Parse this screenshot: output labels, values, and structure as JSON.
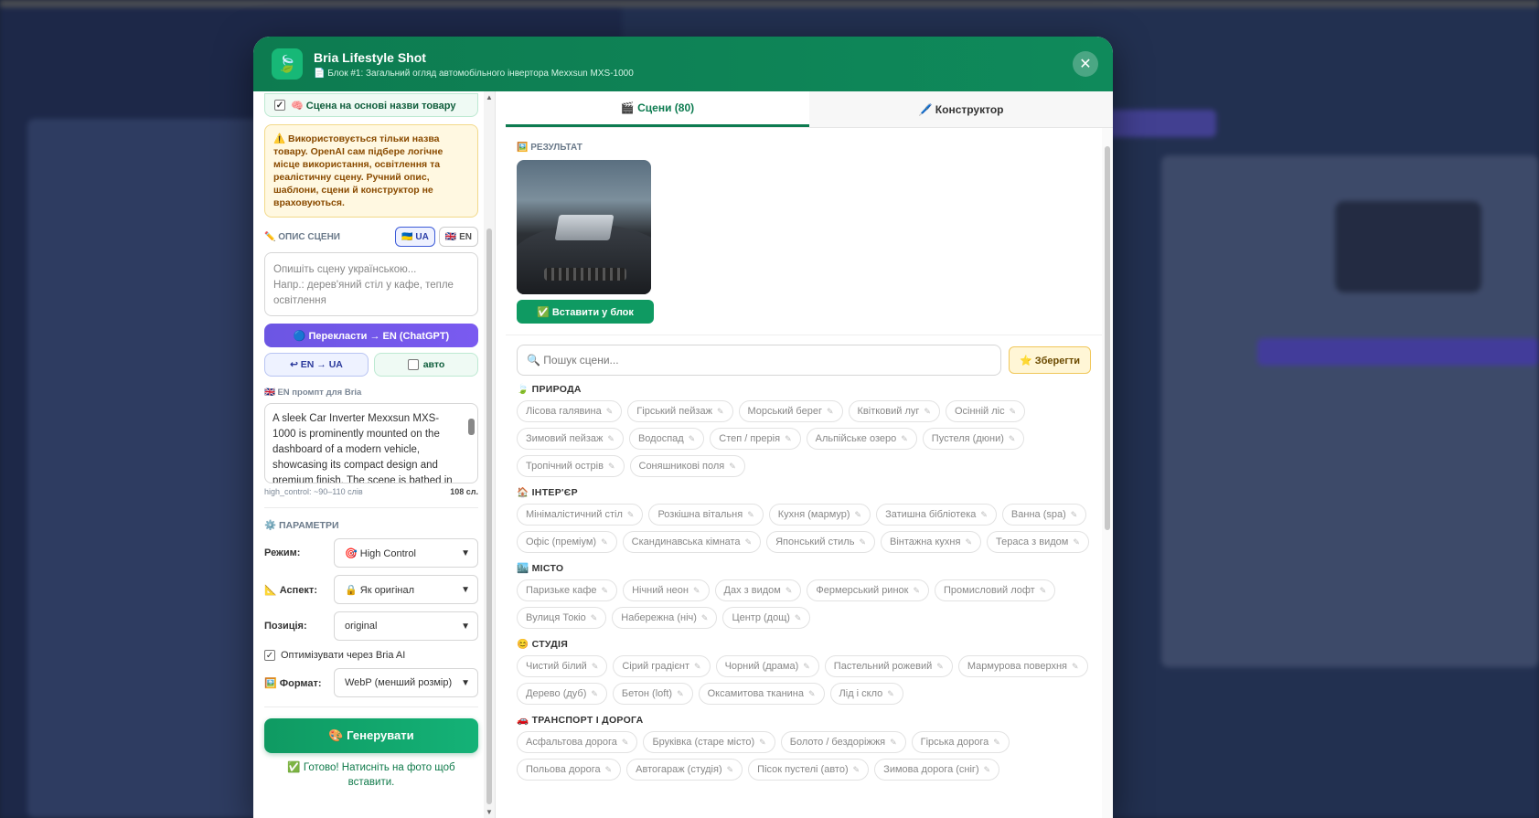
{
  "modal": {
    "title": "Bria Lifestyle Shot",
    "subtitle": "📄 Блок #1: Загальний огляд автомобільного інвертора Mexxsun MXS-1000",
    "close": "✕"
  },
  "left": {
    "scene_from_name": "🧠 Сцена на основі назви товару",
    "warning": "⚠️ Використовується тільки назва товару. OpenAI сам підбере логічне місце використання, освітлення та реалістичну сцену. Ручний опис, шаблони, сцени й конструктор не враховуються.",
    "scene_desc_label": "✏️ ОПИС СЦЕНИ",
    "lang_ua": "🇺🇦 UA",
    "lang_en": "🇬🇧 EN",
    "scene_placeholder": "Опишіть сцену українською...\nНапр.: дерев'яний стіл у кафе, тепле освітлення",
    "translate_btn": "🔵 Перекласти → EN (ChatGPT)",
    "en_ua_btn": "↩ EN → UA",
    "auto_label": "авто",
    "en_prompt_label": "🇬🇧 EN промпт для Bria",
    "en_prompt": "A sleek Car Inverter Mexxsun MXS-1000 is prominently mounted on the dashboard of a modern vehicle, showcasing its compact design and premium finish. The scene is bathed in",
    "meta_left": "high_control: ~90–110 слів",
    "meta_right": "108 сл.",
    "params_label": "⚙️ ПАРАМЕТРИ",
    "params": [
      {
        "label": "Режим:",
        "value": "🎯 High Control"
      },
      {
        "label": "📐 Аспект:",
        "value": "🔒 Як оригінал"
      },
      {
        "label": "Позиція:",
        "value": "original"
      }
    ],
    "optimize_label": "Оптимізувати через Bria AI",
    "format_label": "🖼️ Формат:",
    "format_value": "WebP (менший розмір)",
    "generate_btn": "🎨 Генерувати",
    "ready_text": "✅ Готово! Натисніть на фото щоб вставити."
  },
  "tabs": [
    {
      "label": "🎬 Сцени (80)"
    },
    {
      "label": "🖊️ Конструктор"
    }
  ],
  "result": {
    "label": "🖼️ РЕЗУЛЬТАТ",
    "insert_btn": "✅ Вставити у блок"
  },
  "search": {
    "placeholder": "🔍 Пошук сцени...",
    "save_btn": "⭐ Зберегти"
  },
  "categories": [
    {
      "title": "🍃 ПРИРОДА",
      "items": [
        "Лісова галявина",
        "Гірський пейзаж",
        "Морський берег",
        "Квітковий луг",
        "Осінній ліс",
        "Зимовий пейзаж",
        "Водоспад",
        "Степ / прерія",
        "Альпійське озеро",
        "Пустеля (дюни)",
        "Тропічний острів",
        "Соняшникові поля"
      ]
    },
    {
      "title": "🏠 ІНТЕР'ЄР",
      "items": [
        "Мінімалістичний стіл",
        "Розкішна вітальня",
        "Кухня (мармур)",
        "Затишна бібліотека",
        "Ванна (spa)",
        "Офіс (преміум)",
        "Скандинавська кімната",
        "Японський стиль",
        "Вінтажна кухня",
        "Тераса з видом"
      ]
    },
    {
      "title": "🏙️ МІСТО",
      "items": [
        "Паризьке кафе",
        "Нічний неон",
        "Дах з видом",
        "Фермерський ринок",
        "Промисловий лофт",
        "Вулиця Токіо",
        "Набережна (ніч)",
        "Центр (дощ)"
      ]
    },
    {
      "title": "😊 СТУДІЯ",
      "items": [
        "Чистий білий",
        "Сірий градієнт",
        "Чорний (драма)",
        "Пастельний рожевий",
        "Мармурова поверхня",
        "Дерево (дуб)",
        "Бетон (loft)",
        "Оксамитова тканина",
        "Лід і скло"
      ]
    },
    {
      "title": "🚗 ТРАНСПОРТ І ДОРОГА",
      "items": [
        "Асфальтова дорога",
        "Бруківка (старе місто)",
        "Болото / бездоріжжя",
        "Гірська дорога",
        "Польова дорога",
        "Автогараж (студія)",
        "Пісок пустелі (авто)",
        "Зимова дорога (сніг)"
      ]
    }
  ]
}
